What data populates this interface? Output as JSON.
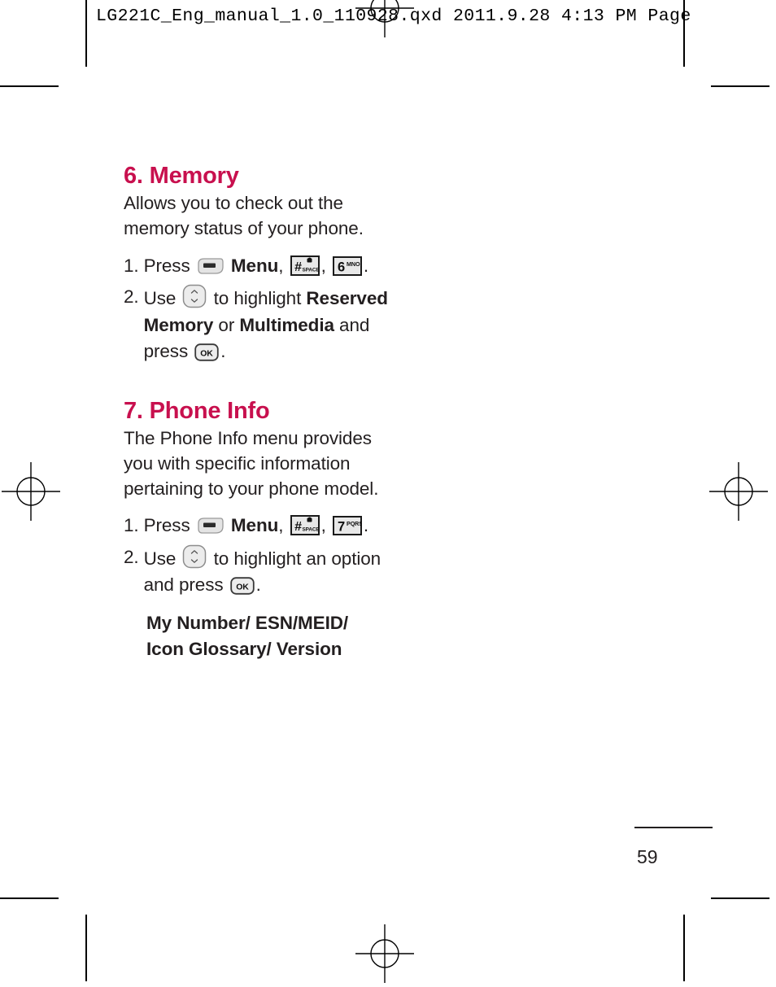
{
  "print_header": {
    "text": "LG221C_Eng_manual_1.0_110928.qxd  2011.9.28  4:13 PM  Page"
  },
  "sections": [
    {
      "title": "6. Memory",
      "intro": "Allows you to check out the memory status of your phone.",
      "steps": [
        {
          "number": "1.",
          "parts": [
            {
              "type": "text",
              "value": "Press "
            },
            {
              "type": "key",
              "key": "menu-soft-key"
            },
            {
              "type": "bold",
              "value": " Menu"
            },
            {
              "type": "text",
              "value": ", "
            },
            {
              "type": "key",
              "key": "hash-space-key"
            },
            {
              "type": "text",
              "value": ", "
            },
            {
              "type": "key",
              "key": "six-mno-key"
            },
            {
              "type": "text",
              "value": "."
            }
          ]
        },
        {
          "number": "2.",
          "parts": [
            {
              "type": "text",
              "value": "Use "
            },
            {
              "type": "key",
              "key": "navigation-key"
            },
            {
              "type": "text",
              "value": " to highlight "
            },
            {
              "type": "bold",
              "value": "Reserved Memory"
            },
            {
              "type": "text",
              "value": " or "
            },
            {
              "type": "bold",
              "value": "Multimedia"
            },
            {
              "type": "text",
              "value": " and press "
            },
            {
              "type": "key",
              "key": "ok-key"
            },
            {
              "type": "text",
              "value": "."
            }
          ]
        }
      ],
      "options": []
    },
    {
      "title": "7. Phone Info",
      "intro": "The Phone Info menu provides you with specific information pertaining to your phone model.",
      "steps": [
        {
          "number": "1.",
          "parts": [
            {
              "type": "text",
              "value": "Press "
            },
            {
              "type": "key",
              "key": "menu-soft-key"
            },
            {
              "type": "bold",
              "value": " Menu"
            },
            {
              "type": "text",
              "value": ", "
            },
            {
              "type": "key",
              "key": "hash-space-key"
            },
            {
              "type": "text",
              "value": ", "
            },
            {
              "type": "key",
              "key": "seven-pqrs-key"
            },
            {
              "type": "text",
              "value": "."
            }
          ]
        },
        {
          "number": "2.",
          "parts": [
            {
              "type": "text",
              "value": "Use "
            },
            {
              "type": "key",
              "key": "navigation-key"
            },
            {
              "type": "text",
              "value": " to highlight an option and press "
            },
            {
              "type": "key",
              "key": "ok-key"
            },
            {
              "type": "text",
              "value": "."
            }
          ]
        }
      ],
      "options": [
        "My Number/ ESN/MEID/",
        "Icon Glossary/ Version"
      ]
    }
  ],
  "keys": {
    "hash-space-key": {
      "label": "#",
      "sublabel": "SPACE",
      "has_lock": true
    },
    "six-mno-key": {
      "label": "6",
      "sublabel": "MNO"
    },
    "seven-pqrs-key": {
      "label": "7",
      "sublabel": "PQRS"
    },
    "ok-key": {
      "label": "OK"
    },
    "navigation-key": {
      "label": ""
    },
    "menu-soft-key": {
      "label": ""
    }
  },
  "footer": {
    "page_number": "59"
  },
  "colors": {
    "heading": "#C8104E",
    "body_text": "#231f20",
    "key_fill": "#e8e8e8",
    "key_border": "#1a1a1a"
  }
}
